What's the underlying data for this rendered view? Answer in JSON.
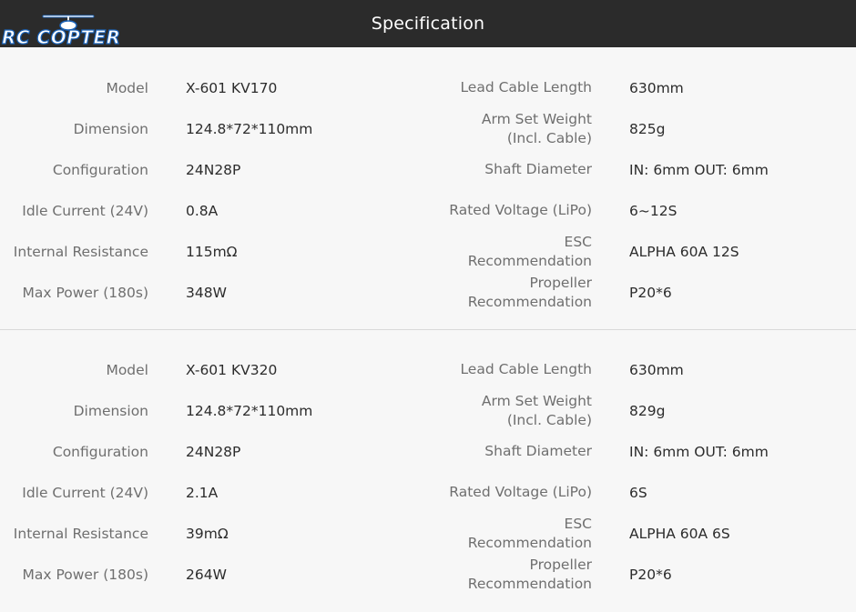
{
  "header": {
    "title": "Specification",
    "logo_text": "RC COPTER"
  },
  "labels": {
    "left": [
      "Model",
      "Dimension",
      "Configuration",
      "Idle Current (24V)",
      "Internal Resistance",
      "Max Power (180s)"
    ],
    "right": [
      "Lead Cable Length",
      "Arm Set Weight\n(Incl. Cable)",
      "Shaft Diameter",
      "Rated Voltage (LiPo)",
      "ESC\nRecommendation",
      "Propeller\nRecommendation"
    ]
  },
  "sections": [
    {
      "left_values": [
        "X-601 KV170",
        "124.8*72*110mm",
        "24N28P",
        "0.8A",
        "115mΩ",
        "348W"
      ],
      "right_values": [
        "630mm",
        "825g",
        "IN: 6mm OUT: 6mm",
        "6~12S",
        "ALPHA 60A 12S",
        "P20*6"
      ]
    },
    {
      "left_values": [
        "X-601 KV320",
        "124.8*72*110mm",
        "24N28P",
        "2.1A",
        "39mΩ",
        "264W"
      ],
      "right_values": [
        "630mm",
        "829g",
        "IN: 6mm OUT: 6mm",
        "6S",
        "ALPHA 60A 6S",
        "P20*6"
      ]
    }
  ],
  "colors": {
    "header_bg": "#2b2b2b",
    "page_bg": "#f7f7f7",
    "label": "#6f6f6f",
    "value": "#2c2c2c",
    "logo_blue": "#1a62b8"
  }
}
